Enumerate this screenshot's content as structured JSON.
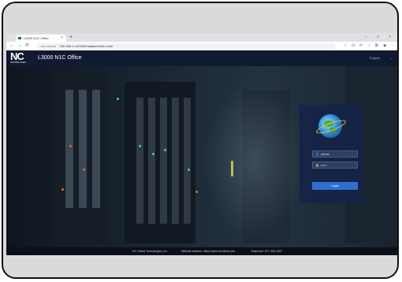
{
  "browser": {
    "tab_title": "L3000 N1C Office",
    "tab_close": "×",
    "new_tab": "+",
    "window_controls": [
      "–",
      "□",
      "×"
    ],
    "nav": [
      "←",
      "→",
      "⟳"
    ],
    "secure_label": "Not secure",
    "url": "192.168.1.xx/l3000/datatech/full-mode",
    "toolbar_icons": [
      "☆",
      "⊡",
      "⟳",
      "☆",
      "⧉",
      "◉",
      "⋯"
    ]
  },
  "site": {
    "logo_text": "NC",
    "logo_sub": "TECHNOLOGIES",
    "title": "L3000 N1C Office",
    "language": "English",
    "language_chevron": "⌄"
  },
  "login": {
    "username_icon": "👤",
    "username_value": "admin",
    "password_icon": "🔒",
    "password_value": "•••••",
    "button_label": "Login"
  },
  "footer": {
    "company": "N1 Critical Technologies, Inc.",
    "website": "Website address:    https://www.n1critical.com",
    "phone": "Telephone:    877-326-1097"
  },
  "colors": {
    "header_bg": "#101a32",
    "panel_bg": "#142248",
    "button_bg": "#2e6fd0"
  }
}
